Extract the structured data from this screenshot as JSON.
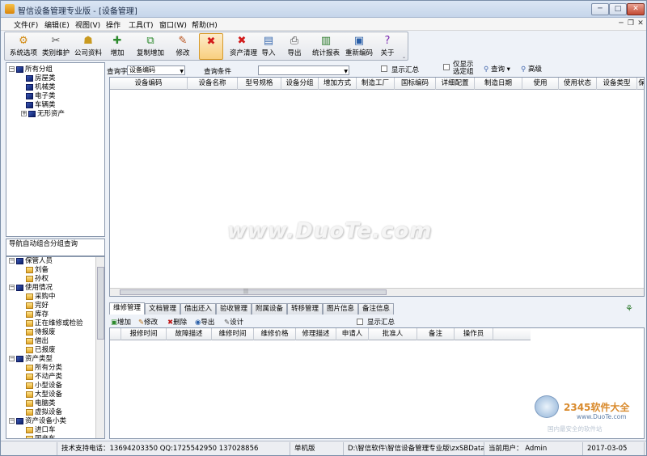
{
  "window": {
    "title": "智信设备管理专业版 - [设备管理]",
    "min": "─",
    "max": "□",
    "close": "✕"
  },
  "menu": [
    "文件(F)",
    "编辑(E)",
    "视图(V)",
    "操作",
    "工具(T)",
    "窗口(W)",
    "帮助(H)"
  ],
  "mdi": {
    "min": "─",
    "restore": "❐",
    "close": "✕"
  },
  "toolbar": {
    "buttons": [
      {
        "label": "系统选项",
        "icon": "⚙",
        "color": "#d28a12"
      },
      {
        "label": "类别维护",
        "icon": "✂",
        "color": "#555"
      },
      {
        "label": "公司资料",
        "icon": "☗",
        "color": "#c99a20"
      },
      {
        "label": "增加",
        "icon": "✚",
        "color": "#2d8a2d"
      },
      {
        "label": "复制增加",
        "icon": "⧉",
        "color": "#2d8a2d"
      },
      {
        "label": "修改",
        "icon": "✎",
        "color": "#b8501a"
      },
      {
        "label": "",
        "icon": "✖",
        "color": "#d21a1a"
      },
      {
        "label": "资产清理",
        "icon": "✖",
        "color": "#d21a1a"
      },
      {
        "label": "导入",
        "icon": "▤",
        "color": "#3a6bb0"
      },
      {
        "label": "导出",
        "icon": "⎙",
        "color": "#444"
      },
      {
        "label": "统计报表",
        "icon": "▥",
        "color": "#2a7a2a"
      },
      {
        "label": "重新编码",
        "icon": "▣",
        "color": "#2a5fa8"
      },
      {
        "label": "关于",
        "icon": "?",
        "color": "#7a2ab0"
      }
    ]
  },
  "tree_assets": {
    "root": "所有分组",
    "items": [
      "房屋类",
      "机械类",
      "电子类",
      "车辆类",
      "无形资产"
    ]
  },
  "nav": {
    "header": "导航自动组合分组查询",
    "groups": [
      {
        "label": "保管人员",
        "items": [
          "刘备",
          "孙权"
        ]
      },
      {
        "label": "使用情况",
        "items": [
          "采购中",
          "完好",
          "库存",
          "正在维修或检验",
          "待报废",
          "借出",
          "已报废"
        ]
      },
      {
        "label": "资产类型",
        "items": [
          "所有分类",
          "不动产类",
          "小型设备",
          "大型设备",
          "电脑类",
          "虚拟设备"
        ]
      },
      {
        "label": "资产设备小类",
        "items": [
          "进口车",
          "国产车"
        ]
      }
    ]
  },
  "filter": {
    "field_label": "查询字段",
    "field_value": "设备编码",
    "cond_label": "查询条件",
    "cond_value": "",
    "show_summary": "显示汇总",
    "only_selected": "仅显示\n选定组",
    "query": "查询",
    "advanced": "高级"
  },
  "grid1": {
    "columns": [
      "设备编码",
      "设备名称",
      "型号规格",
      "设备分组",
      "增加方式",
      "制造工厂",
      "国标编码",
      "详细配置",
      "制造日期",
      "使用",
      "使用状态",
      "设备类型",
      "保"
    ]
  },
  "tabs": [
    "维修管理",
    "文档管理",
    "借出还入",
    "验收管理",
    "附属设备",
    "转移管理",
    "图片信息",
    "备注信息"
  ],
  "subtoolbar": {
    "add": "增加",
    "edit": "修改",
    "delete": "删除",
    "export": "导出",
    "design": "设计",
    "show_summary": "显示汇总"
  },
  "grid2": {
    "columns": [
      "报修时间",
      "故障描述",
      "维修时间",
      "维修价格",
      "修理描述",
      "申请人",
      "批准人",
      "备注",
      "操作员"
    ]
  },
  "status": {
    "support": "技术支持电话：13694203350 QQ:1725542950 137028856",
    "mode": "单机版",
    "path": "D:\\智信软件\\智信设备管理专业版\\zxSBData.sys",
    "user": "当前用户： Admin",
    "date": "2017-03-05"
  },
  "watermark": {
    "main": "www.DuoTe.com",
    "logo_text": "2345软件大全",
    "logo_url": "www.DuoTe.com",
    "logo_sub": "国内最安全的软件站"
  }
}
